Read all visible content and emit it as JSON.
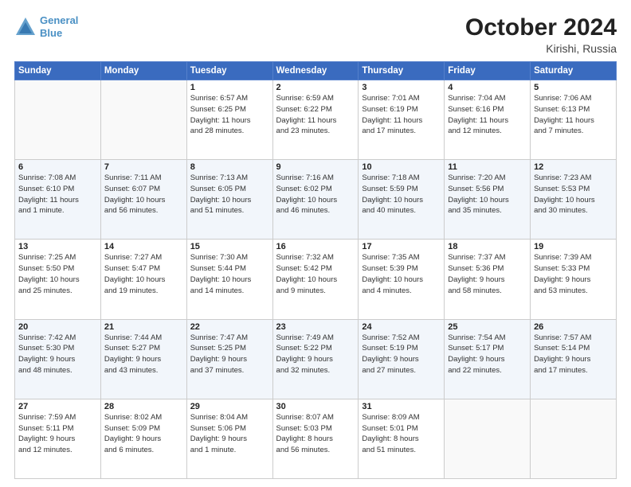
{
  "header": {
    "logo_line1": "General",
    "logo_line2": "Blue",
    "month": "October 2024",
    "location": "Kirishi, Russia"
  },
  "weekdays": [
    "Sunday",
    "Monday",
    "Tuesday",
    "Wednesday",
    "Thursday",
    "Friday",
    "Saturday"
  ],
  "weeks": [
    [
      {
        "day": "",
        "info": ""
      },
      {
        "day": "",
        "info": ""
      },
      {
        "day": "1",
        "info": "Sunrise: 6:57 AM\nSunset: 6:25 PM\nDaylight: 11 hours\nand 28 minutes."
      },
      {
        "day": "2",
        "info": "Sunrise: 6:59 AM\nSunset: 6:22 PM\nDaylight: 11 hours\nand 23 minutes."
      },
      {
        "day": "3",
        "info": "Sunrise: 7:01 AM\nSunset: 6:19 PM\nDaylight: 11 hours\nand 17 minutes."
      },
      {
        "day": "4",
        "info": "Sunrise: 7:04 AM\nSunset: 6:16 PM\nDaylight: 11 hours\nand 12 minutes."
      },
      {
        "day": "5",
        "info": "Sunrise: 7:06 AM\nSunset: 6:13 PM\nDaylight: 11 hours\nand 7 minutes."
      }
    ],
    [
      {
        "day": "6",
        "info": "Sunrise: 7:08 AM\nSunset: 6:10 PM\nDaylight: 11 hours\nand 1 minute."
      },
      {
        "day": "7",
        "info": "Sunrise: 7:11 AM\nSunset: 6:07 PM\nDaylight: 10 hours\nand 56 minutes."
      },
      {
        "day": "8",
        "info": "Sunrise: 7:13 AM\nSunset: 6:05 PM\nDaylight: 10 hours\nand 51 minutes."
      },
      {
        "day": "9",
        "info": "Sunrise: 7:16 AM\nSunset: 6:02 PM\nDaylight: 10 hours\nand 46 minutes."
      },
      {
        "day": "10",
        "info": "Sunrise: 7:18 AM\nSunset: 5:59 PM\nDaylight: 10 hours\nand 40 minutes."
      },
      {
        "day": "11",
        "info": "Sunrise: 7:20 AM\nSunset: 5:56 PM\nDaylight: 10 hours\nand 35 minutes."
      },
      {
        "day": "12",
        "info": "Sunrise: 7:23 AM\nSunset: 5:53 PM\nDaylight: 10 hours\nand 30 minutes."
      }
    ],
    [
      {
        "day": "13",
        "info": "Sunrise: 7:25 AM\nSunset: 5:50 PM\nDaylight: 10 hours\nand 25 minutes."
      },
      {
        "day": "14",
        "info": "Sunrise: 7:27 AM\nSunset: 5:47 PM\nDaylight: 10 hours\nand 19 minutes."
      },
      {
        "day": "15",
        "info": "Sunrise: 7:30 AM\nSunset: 5:44 PM\nDaylight: 10 hours\nand 14 minutes."
      },
      {
        "day": "16",
        "info": "Sunrise: 7:32 AM\nSunset: 5:42 PM\nDaylight: 10 hours\nand 9 minutes."
      },
      {
        "day": "17",
        "info": "Sunrise: 7:35 AM\nSunset: 5:39 PM\nDaylight: 10 hours\nand 4 minutes."
      },
      {
        "day": "18",
        "info": "Sunrise: 7:37 AM\nSunset: 5:36 PM\nDaylight: 9 hours\nand 58 minutes."
      },
      {
        "day": "19",
        "info": "Sunrise: 7:39 AM\nSunset: 5:33 PM\nDaylight: 9 hours\nand 53 minutes."
      }
    ],
    [
      {
        "day": "20",
        "info": "Sunrise: 7:42 AM\nSunset: 5:30 PM\nDaylight: 9 hours\nand 48 minutes."
      },
      {
        "day": "21",
        "info": "Sunrise: 7:44 AM\nSunset: 5:27 PM\nDaylight: 9 hours\nand 43 minutes."
      },
      {
        "day": "22",
        "info": "Sunrise: 7:47 AM\nSunset: 5:25 PM\nDaylight: 9 hours\nand 37 minutes."
      },
      {
        "day": "23",
        "info": "Sunrise: 7:49 AM\nSunset: 5:22 PM\nDaylight: 9 hours\nand 32 minutes."
      },
      {
        "day": "24",
        "info": "Sunrise: 7:52 AM\nSunset: 5:19 PM\nDaylight: 9 hours\nand 27 minutes."
      },
      {
        "day": "25",
        "info": "Sunrise: 7:54 AM\nSunset: 5:17 PM\nDaylight: 9 hours\nand 22 minutes."
      },
      {
        "day": "26",
        "info": "Sunrise: 7:57 AM\nSunset: 5:14 PM\nDaylight: 9 hours\nand 17 minutes."
      }
    ],
    [
      {
        "day": "27",
        "info": "Sunrise: 7:59 AM\nSunset: 5:11 PM\nDaylight: 9 hours\nand 12 minutes."
      },
      {
        "day": "28",
        "info": "Sunrise: 8:02 AM\nSunset: 5:09 PM\nDaylight: 9 hours\nand 6 minutes."
      },
      {
        "day": "29",
        "info": "Sunrise: 8:04 AM\nSunset: 5:06 PM\nDaylight: 9 hours\nand 1 minute."
      },
      {
        "day": "30",
        "info": "Sunrise: 8:07 AM\nSunset: 5:03 PM\nDaylight: 8 hours\nand 56 minutes."
      },
      {
        "day": "31",
        "info": "Sunrise: 8:09 AM\nSunset: 5:01 PM\nDaylight: 8 hours\nand 51 minutes."
      },
      {
        "day": "",
        "info": ""
      },
      {
        "day": "",
        "info": ""
      }
    ]
  ]
}
